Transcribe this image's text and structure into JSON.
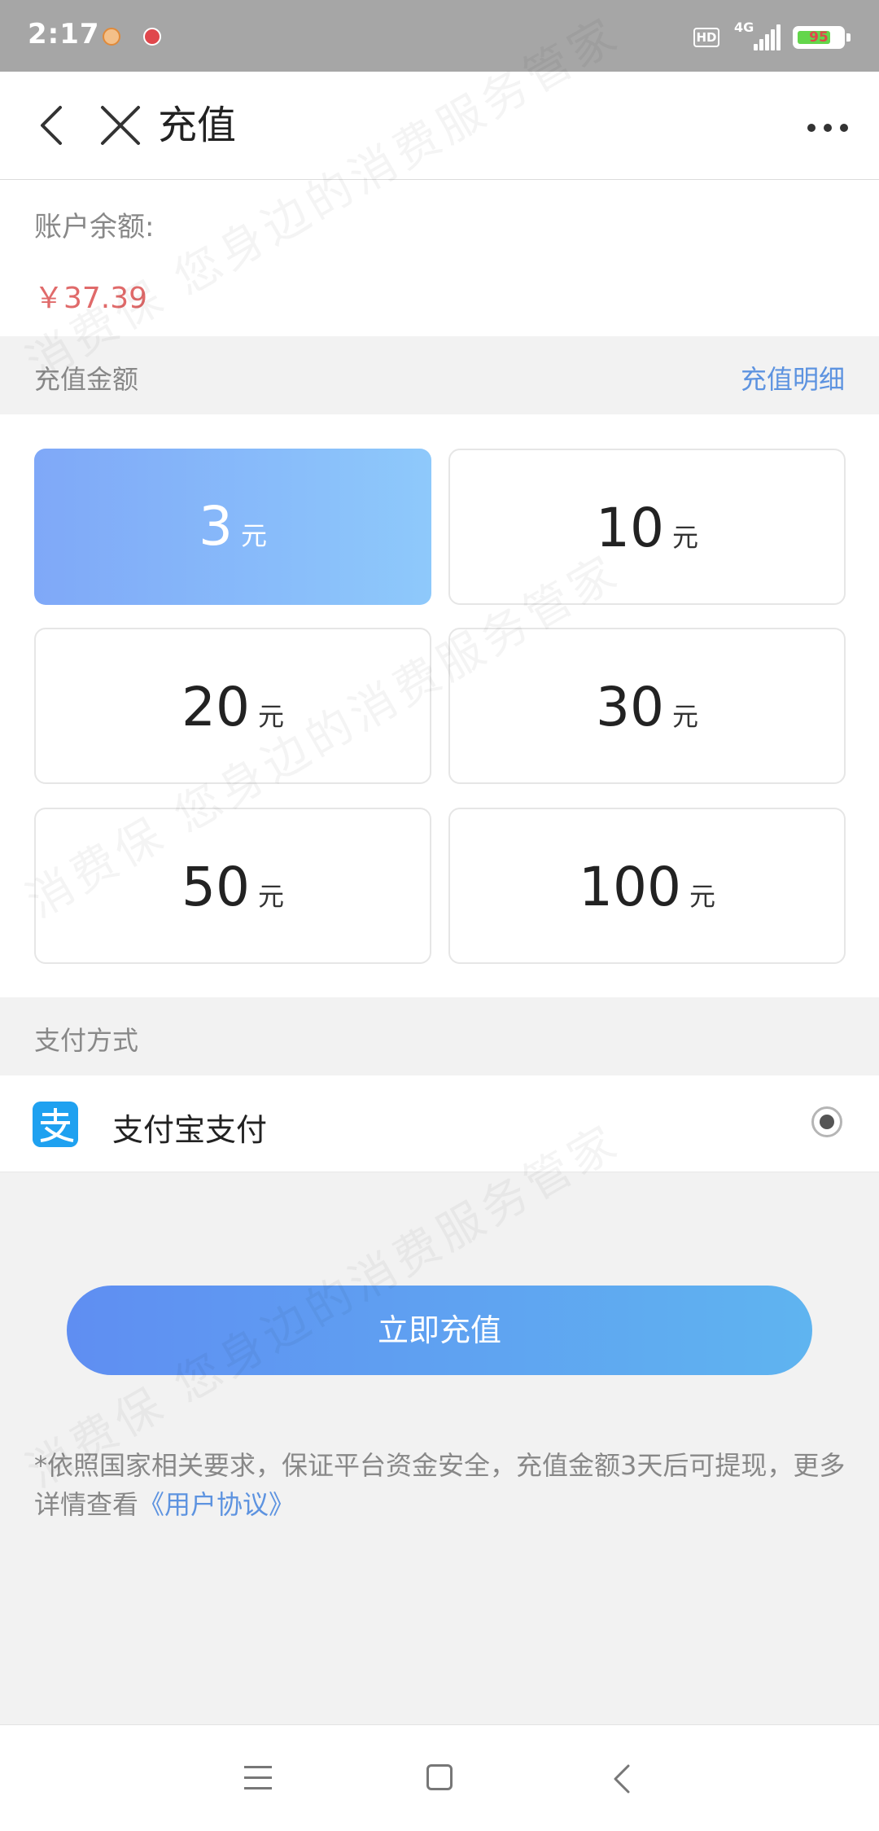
{
  "status_bar": {
    "time": "2:17",
    "hd": "HD",
    "network": "4G",
    "battery": "95",
    "icons": [
      "notification-app-icon",
      "notification-app-icon",
      "signal-icon",
      "battery-icon"
    ]
  },
  "nav": {
    "title": "充值",
    "icons": [
      "back-icon",
      "close-icon",
      "more-icon"
    ]
  },
  "balance": {
    "label": "账户余额:",
    "value": "￥37.39"
  },
  "amount_section": {
    "title": "充值金额",
    "detail_link": "充值明细",
    "options": [
      {
        "amount": "3",
        "unit": "元",
        "selected": true
      },
      {
        "amount": "10",
        "unit": "元",
        "selected": false
      },
      {
        "amount": "20",
        "unit": "元",
        "selected": false
      },
      {
        "amount": "30",
        "unit": "元",
        "selected": false
      },
      {
        "amount": "50",
        "unit": "元",
        "selected": false
      },
      {
        "amount": "100",
        "unit": "元",
        "selected": false
      }
    ]
  },
  "payment_section": {
    "title": "支付方式",
    "method": {
      "label": "支付宝支付",
      "icon": "alipay-icon",
      "selected": true
    }
  },
  "submit": {
    "label": "立即充值"
  },
  "notice": {
    "text": "*依照国家相关要求，保证平台资金安全，充值金额3天后可提现，更多详情查看",
    "link": "《用户协议》"
  },
  "watermark": {
    "lines": [
      "消费保 您身边的消费服务管家",
      "消费保 您身边的消费服务管家",
      "消费保 您身边的消费服务管家"
    ]
  },
  "colors": {
    "accent": "#5d93e0",
    "balance": "#e06a6a",
    "button_start": "#5f8ef2",
    "button_end": "#5fb4f0",
    "selected_start": "#7fa8f8",
    "selected_end": "#8ec9fb"
  }
}
